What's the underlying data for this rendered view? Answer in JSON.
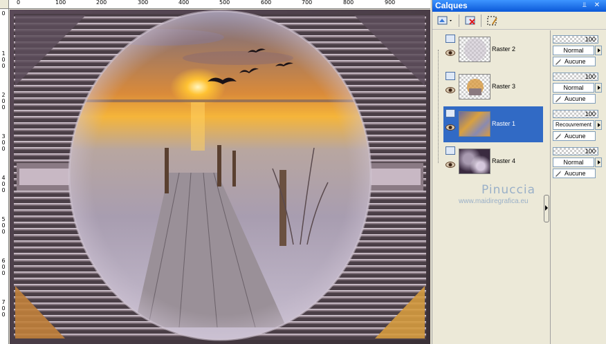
{
  "ruler": {
    "top_labels": [
      "0",
      "100",
      "200",
      "300",
      "400",
      "500",
      "600",
      "700",
      "800",
      "900"
    ],
    "left_labels": [
      "0",
      "100",
      "200",
      "300",
      "400",
      "500",
      "600",
      "700"
    ]
  },
  "panel": {
    "title": "Calques",
    "pin_icon": "pin-icon",
    "close_icon": "close-icon"
  },
  "layers": [
    {
      "name": "Raster 2",
      "opacity": "100",
      "mode": "Normal",
      "mask": "Aucune",
      "selected": false
    },
    {
      "name": "Raster 3",
      "opacity": "100",
      "mode": "Normal",
      "mask": "Aucune",
      "selected": false
    },
    {
      "name": "Raster 1",
      "opacity": "100",
      "mode": "Recouvrement",
      "mask": "Aucune",
      "selected": true
    },
    {
      "name": "Raster 4",
      "opacity": "100",
      "mode": "Normal",
      "mask": "Aucune",
      "selected": false
    }
  ],
  "watermark": {
    "name": "Pinuccia",
    "url": "www.maidiregrafica.eu"
  },
  "colors": {
    "selection": "#316ac5",
    "title_bar": "#0a58d8",
    "panel_bg": "#ece9d8"
  }
}
